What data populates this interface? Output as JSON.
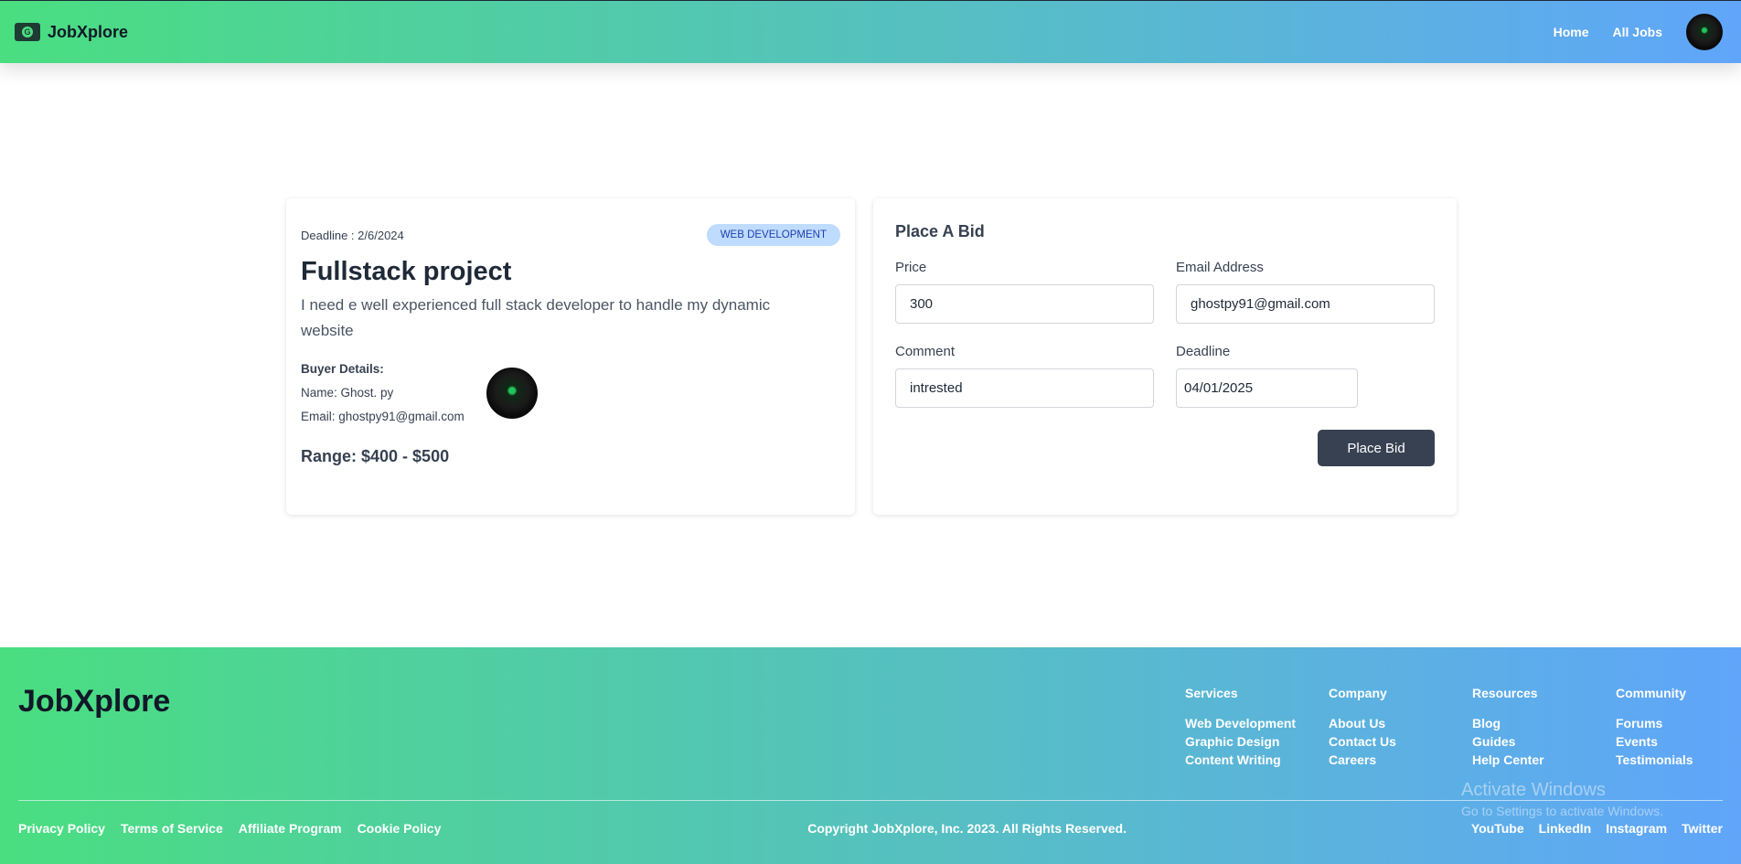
{
  "navbar": {
    "brand": "JobXplore",
    "links": [
      "Home",
      "All Jobs"
    ]
  },
  "job": {
    "deadline": "Deadline : 2/6/2024",
    "category": "WEB DEVELOPMENT",
    "title": "Fullstack project",
    "description": "I need e well experienced full stack developer to handle my dynamic website",
    "buyer_heading": "Buyer Details:",
    "buyer_name": "Name: Ghost. py",
    "buyer_email": "Email: ghostpy91@gmail.com",
    "range": "Range: $400 - $500"
  },
  "bid": {
    "title": "Place A Bid",
    "price_label": "Price",
    "price_value": "300",
    "email_label": "Email Address",
    "email_value": "ghostpy91@gmail.com",
    "comment_label": "Comment",
    "comment_value": "intrested",
    "deadline_label": "Deadline",
    "deadline_value": "04/01/2025",
    "submit_label": "Place Bid"
  },
  "footer": {
    "brand": "JobXplore",
    "columns": [
      {
        "title": "Services",
        "links": [
          "Web Development",
          "Graphic Design",
          "Content Writing"
        ]
      },
      {
        "title": "Company",
        "links": [
          "About Us",
          "Contact Us",
          "Careers"
        ]
      },
      {
        "title": "Resources",
        "links": [
          "Blog",
          "Guides",
          "Help Center"
        ]
      },
      {
        "title": "Community",
        "links": [
          "Forums",
          "Events",
          "Testimonials"
        ]
      }
    ],
    "bottom_links": [
      "Privacy Policy",
      "Terms of Service",
      "Affiliate Program",
      "Cookie Policy"
    ],
    "copyright": "Copyright JobXplore, Inc. 2023. All Rights Reserved.",
    "socials": [
      "YouTube",
      "LinkedIn",
      "Instagram",
      "Twitter"
    ]
  },
  "watermark": {
    "title": "Activate Windows",
    "subtitle": "Go to Settings to activate Windows."
  },
  "colors": {
    "gradient_start": "#4ade80",
    "gradient_end": "#60a5fa",
    "button_bg": "#374151",
    "tag_bg": "#bfdbfe"
  }
}
